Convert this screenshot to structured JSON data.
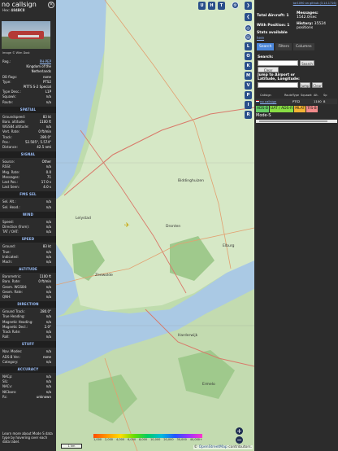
{
  "aircraft": {
    "callsign": "no callsign",
    "hex_label": "Hex:",
    "hex": "484BC8",
    "photo_credit": "Image © Wim Dost"
  },
  "details": [
    {
      "k": "Reg.:",
      "v": "PH-PEP",
      "link": true
    },
    {
      "k": "",
      "v": "Kingdom of the"
    },
    {
      "k": "",
      "v": "Netherlands"
    },
    {
      "k": "DB flags:",
      "v": "none"
    },
    {
      "k": "Type:",
      "v": "PTS2"
    },
    {
      "k": "",
      "v": "PITTS S-2 Special"
    },
    {
      "k": "Type Desc.:",
      "v": "L1P"
    },
    {
      "k": "Squawk:",
      "v": "n/a"
    },
    {
      "k": "Route:",
      "v": "n/a"
    }
  ],
  "sections": {
    "spatial": {
      "title": "SPATIAL",
      "rows": [
        {
          "k": "Groundspeed:",
          "v": "83 kt"
        },
        {
          "k": "Baro. altitude:",
          "v": "1100 ft"
        },
        {
          "k": "WGS84 altitude:",
          "v": "n/a"
        },
        {
          "k": "Vert. Rate:",
          "v": "0 ft/min"
        },
        {
          "k": "Track:",
          "v": "280.0°"
        },
        {
          "k": "Pos.:",
          "v": "52.505°, 5.574°"
        },
        {
          "k": "Distance:",
          "v": "42.5 nmi"
        }
      ]
    },
    "signal": {
      "title": "SIGNAL",
      "rows": [
        {
          "k": "Source:",
          "v": "Other"
        },
        {
          "k": "RSSI:",
          "v": "n/a"
        },
        {
          "k": "Msg. Rate:",
          "v": "0.0"
        },
        {
          "k": "Messages:",
          "v": "71"
        },
        {
          "k": "Last Pos.:",
          "v": "17.0 s"
        },
        {
          "k": "Last Seen:",
          "v": "4.0 s"
        }
      ]
    },
    "fms": {
      "title": "FMS SEL",
      "rows": [
        {
          "k": "Sel. Alt.:",
          "v": "n/a"
        },
        {
          "k": "Sel. Head.:",
          "v": "n/a"
        }
      ]
    },
    "wind": {
      "title": "WIND",
      "rows": [
        {
          "k": "Speed:",
          "v": "n/a"
        },
        {
          "k": "Direction (from):",
          "v": "n/a"
        },
        {
          "k": "TAT / OAT:",
          "v": "n/a"
        }
      ]
    },
    "speed": {
      "title": "SPEED",
      "rows": [
        {
          "k": "Ground:",
          "v": "83 kt"
        },
        {
          "k": "True:",
          "v": "n/a"
        },
        {
          "k": "Indicated:",
          "v": "n/a"
        },
        {
          "k": "Mach:",
          "v": "n/a"
        }
      ]
    },
    "altitude": {
      "title": "ALTITUDE",
      "rows": [
        {
          "k": "Barometric:",
          "v": "1100 ft"
        },
        {
          "k": "Baro. Rate:",
          "v": "0 ft/min"
        },
        {
          "k": "Geom. WGS84:",
          "v": "n/a"
        },
        {
          "k": "Geom. Rate:",
          "v": "n/a"
        },
        {
          "k": "QNH:",
          "v": "n/a"
        }
      ]
    },
    "direction": {
      "title": "DIRECTION",
      "rows": [
        {
          "k": "Ground Track:",
          "v": "280.0°"
        },
        {
          "k": "True Heading:",
          "v": "n/a"
        },
        {
          "k": "Magnetic Heading:",
          "v": "n/a"
        },
        {
          "k": "Magnetic Decl.:",
          "v": "2.0°"
        },
        {
          "k": "Track Rate:",
          "v": "n/a"
        },
        {
          "k": "Roll:",
          "v": "n/a"
        }
      ]
    },
    "stuff": {
      "title": "STUFF",
      "rows": [
        {
          "k": "Nav. Modes:",
          "v": "n/a"
        },
        {
          "k": "ADS-B Ver.:",
          "v": "none"
        },
        {
          "k": "Category:",
          "v": "n/a"
        }
      ]
    },
    "accuracy": {
      "title": "ACCURACY",
      "rows": [
        {
          "k": "NACp:",
          "v": "n/a"
        },
        {
          "k": "SIL:",
          "v": "n/a"
        },
        {
          "k": "NACv:",
          "v": "n/a"
        },
        {
          "k": "NICbaro:",
          "v": "n/a"
        },
        {
          "k": "Rc:",
          "v": "unknown"
        }
      ]
    }
  },
  "footer_note": "Learn more about Mode S data type by hovering over each data label.",
  "map": {
    "top_buttons": [
      "U",
      "H",
      "T"
    ],
    "side_buttons": [
      "L",
      "O",
      "K",
      "M",
      "V",
      "P",
      "I",
      "R"
    ],
    "places": [
      "Lelystad",
      "Biddinghuizen",
      "Dronten",
      "Elburg",
      "Harderwijk",
      "Zeewolde",
      "Ermelo"
    ],
    "alt_ticks": [
      "1,000",
      "2,000",
      "4,000",
      "6,000",
      "8,000",
      "10,000",
      "20,000",
      "30,000",
      "40,000+"
    ],
    "scale": "1 km",
    "attribution_prefix": "©",
    "attribution_osm": "OpenStreetMap",
    "attribution_suffix": "contributors."
  },
  "stats": {
    "version": "tar1090 on github (3.14.1716)",
    "total_label": "Total Aircraft:",
    "total": "1",
    "messages_label": "Messages:",
    "messages": "1542.0/sec",
    "with_pos_label": "With Position:",
    "with_pos": "1",
    "history_label": "History:",
    "history": "35524 positions",
    "stats_available": "Stats available",
    "stats_link": "here"
  },
  "right_tabs": [
    "Search",
    "Filters",
    "Columns"
  ],
  "search": {
    "label": "Search:",
    "button": "Search",
    "clear": "Clear Search",
    "jump_label": "Jump to Airport or Latitude, Longitude:",
    "jump_button": "Jump",
    "jump_clear": "Clear"
  },
  "table": {
    "headers": [
      "",
      "Callsign",
      "Route",
      "Type",
      "Squawk",
      "Alt. (ft)",
      "Sp"
    ],
    "rows": [
      {
        "callsign": "no callsign",
        "route": "",
        "type": "PTS2",
        "squawk": "",
        "alt": "1100",
        "sp": "8"
      }
    ]
  },
  "filter_chips": [
    {
      "label": "ADS-B",
      "color": "#66cc66"
    },
    {
      "label": "UAT / ADS-R",
      "color": "#88dd44"
    },
    {
      "label": "MLAT",
      "color": "#f2b233"
    },
    {
      "label": "TIS-B",
      "color": "#f28b8b"
    }
  ],
  "modes_label": "Mode-S"
}
